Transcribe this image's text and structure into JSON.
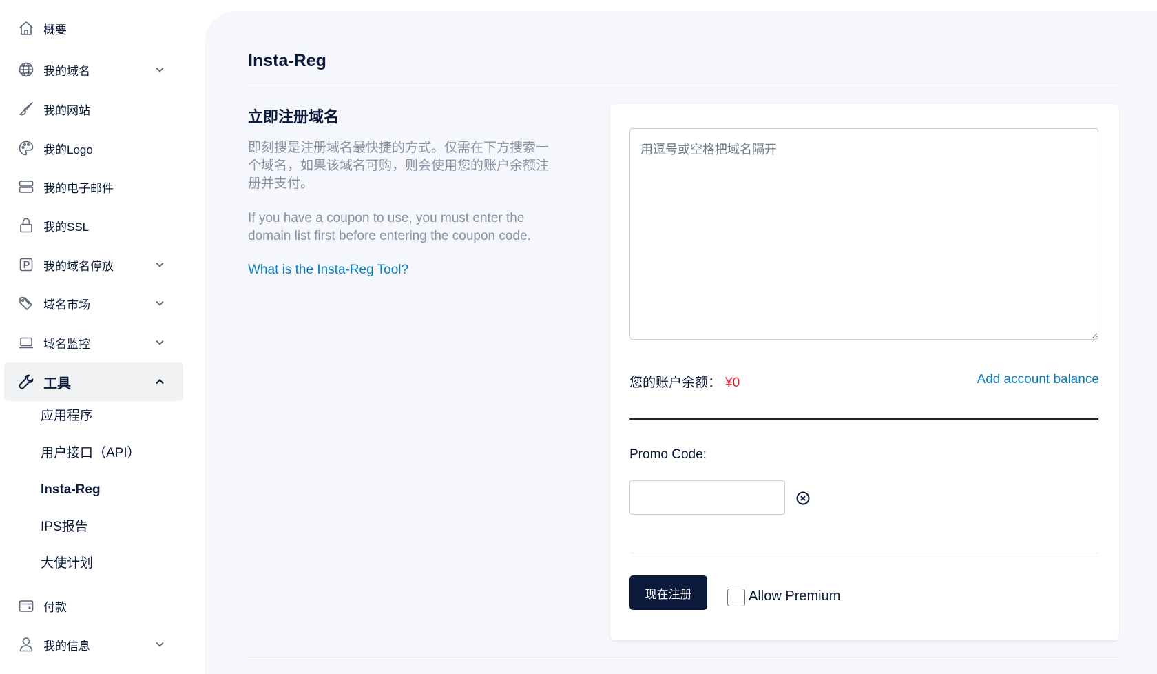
{
  "sidebar": {
    "items": [
      {
        "label": "概要",
        "icon": "home-icon"
      },
      {
        "label": "我的域名",
        "icon": "globe-icon"
      },
      {
        "label": "我的网站",
        "icon": "brush-icon"
      },
      {
        "label": "我的Logo",
        "icon": "palette-icon"
      },
      {
        "label": "我的电子邮件",
        "icon": "server-icon"
      },
      {
        "label": "我的SSL",
        "icon": "lock-icon"
      },
      {
        "label": "我的域名停放",
        "icon": "parking-icon"
      },
      {
        "label": "域名市场",
        "icon": "tag-icon"
      },
      {
        "label": "域名监控",
        "icon": "laptop-icon"
      },
      {
        "label": "工具",
        "icon": "wrench-icon"
      },
      {
        "label": "付款",
        "icon": "wallet-icon"
      },
      {
        "label": "我的信息",
        "icon": "user-icon"
      }
    ],
    "tools_sub": [
      {
        "label": "应用程序"
      },
      {
        "label": "用户接口（API）"
      },
      {
        "label": "Insta-Reg"
      },
      {
        "label": "IPS报告"
      },
      {
        "label": "大使计划"
      }
    ]
  },
  "main": {
    "title": "Insta-Reg",
    "intro": {
      "heading": "立即注册域名",
      "text_cn": "即刻搜是注册域名最快捷的方式。仅需在下方搜索一个域名，如果该域名可购，则会使用您的账户余额注册并支付。",
      "text_en": "If you have a coupon to use, you must enter the domain list first before entering the coupon code.",
      "help_link": "What is the Insta-Reg Tool?"
    },
    "form": {
      "domains_placeholder": "用逗号或空格把域名隔开",
      "balance_label": "您的账户余额：",
      "balance_value": "¥0",
      "add_balance": "Add account balance",
      "promo_label": "Promo Code:",
      "register_button": "现在注册",
      "allow_premium": "Allow Premium"
    }
  },
  "colors": {
    "navy": "#0b1a3a",
    "link": "#0a7fbe",
    "balance_red": "#e0202a",
    "panel_bg": "#f5f7fc"
  }
}
